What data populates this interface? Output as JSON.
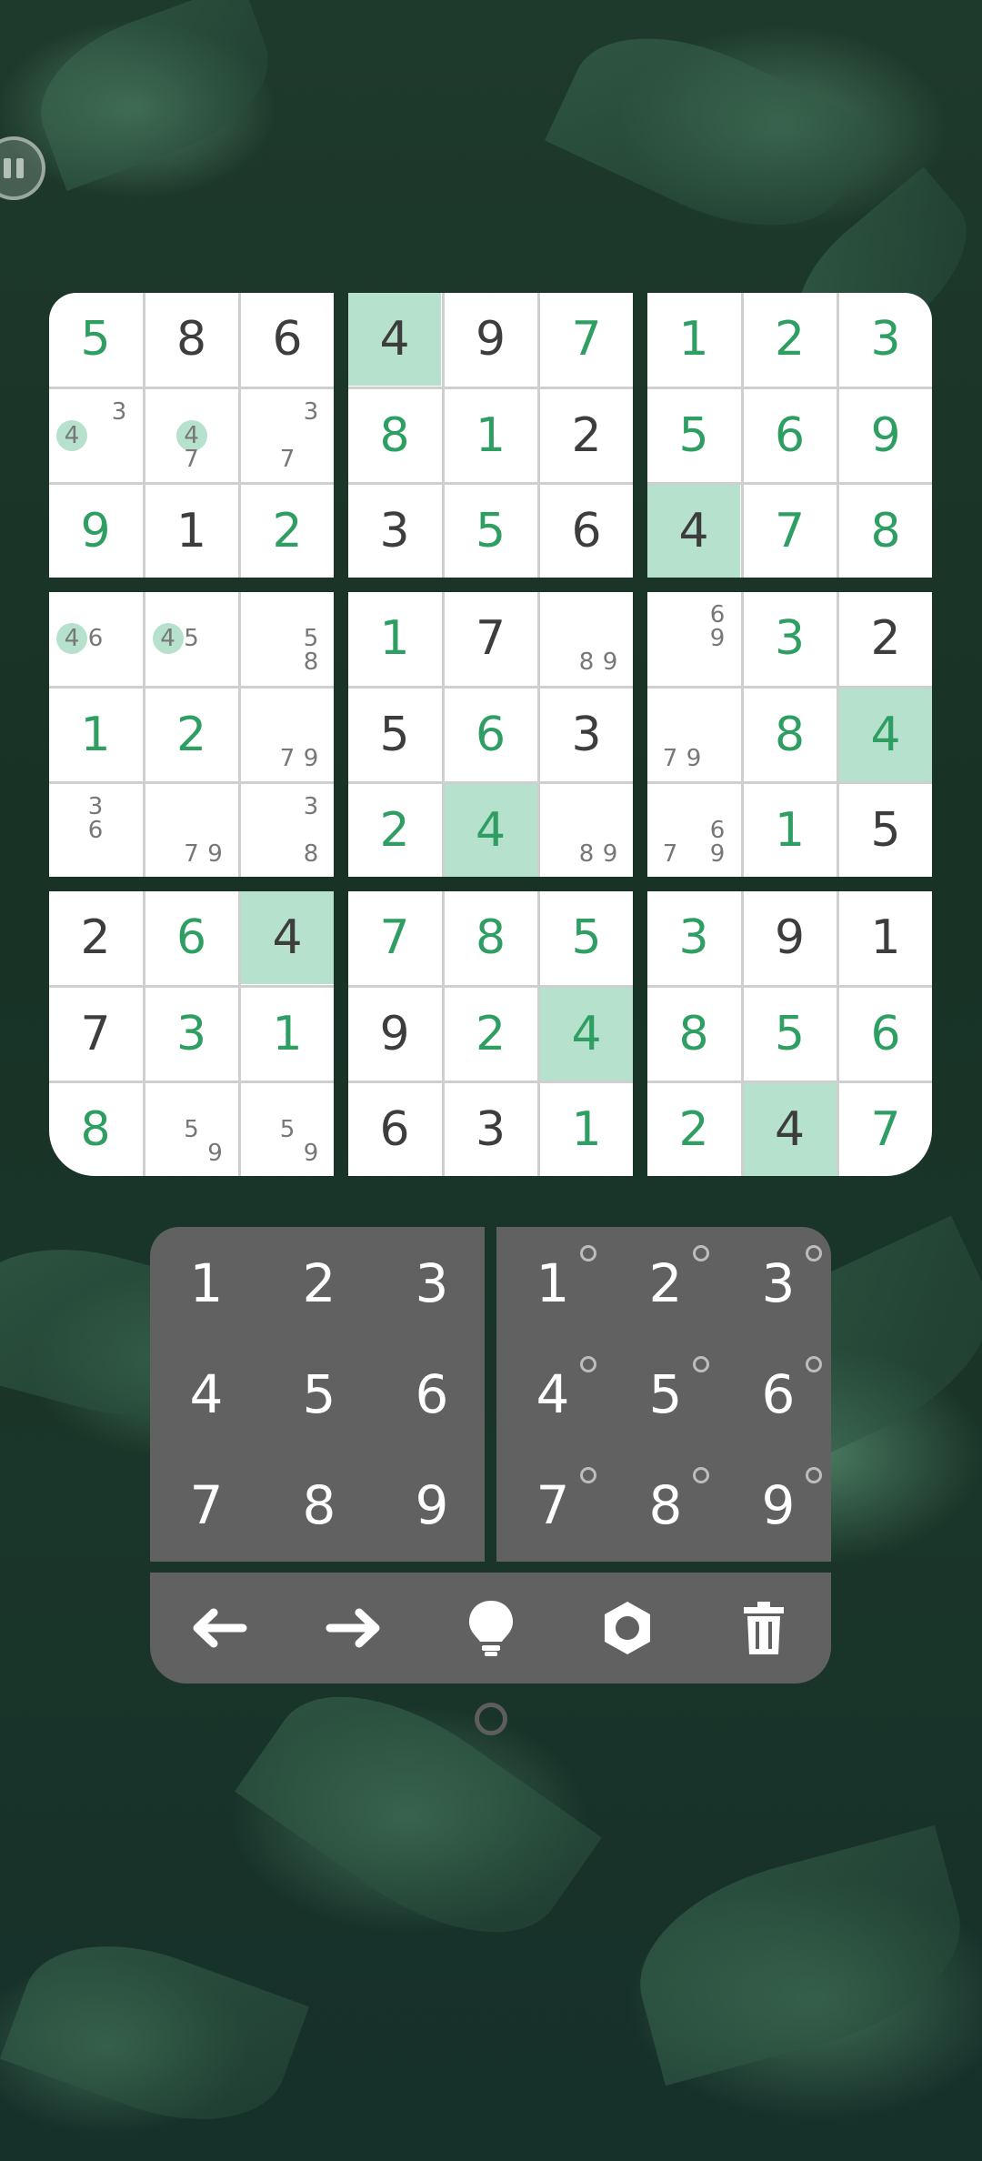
{
  "colors": {
    "accent": "#2e9e63",
    "highlight": "#b6e1cc",
    "given": "#3d3d3d",
    "pad": "#616161"
  },
  "board": {
    "boxes": [
      {
        "cells": [
          {
            "v": "5",
            "t": "user"
          },
          {
            "v": "8",
            "t": "given"
          },
          {
            "v": "6",
            "t": "given"
          },
          {
            "v": "",
            "notes": [
              {
                "d": "4",
                "pos": "ml",
                "mark": true
              },
              {
                "d": "3",
                "pos": "tr"
              }
            ]
          },
          {
            "v": "",
            "notes": [
              {
                "d": "4",
                "pos": "mc",
                "mark": true
              },
              {
                "d": "7",
                "pos": "bc"
              }
            ]
          },
          {
            "v": "",
            "notes": [
              {
                "d": "3",
                "pos": "tr"
              },
              {
                "d": "7",
                "pos": "bc"
              }
            ]
          },
          {
            "v": "9",
            "t": "user"
          },
          {
            "v": "1",
            "t": "given"
          },
          {
            "v": "2",
            "t": "user"
          }
        ]
      },
      {
        "cells": [
          {
            "v": "4",
            "t": "given",
            "hl": true
          },
          {
            "v": "9",
            "t": "given"
          },
          {
            "v": "7",
            "t": "user"
          },
          {
            "v": "8",
            "t": "user"
          },
          {
            "v": "1",
            "t": "user"
          },
          {
            "v": "2",
            "t": "given"
          },
          {
            "v": "3",
            "t": "given"
          },
          {
            "v": "5",
            "t": "user"
          },
          {
            "v": "6",
            "t": "given"
          }
        ]
      },
      {
        "cells": [
          {
            "v": "1",
            "t": "user"
          },
          {
            "v": "2",
            "t": "user"
          },
          {
            "v": "3",
            "t": "user"
          },
          {
            "v": "5",
            "t": "user"
          },
          {
            "v": "6",
            "t": "user"
          },
          {
            "v": "9",
            "t": "user"
          },
          {
            "v": "4",
            "t": "given",
            "hl": true
          },
          {
            "v": "7",
            "t": "user"
          },
          {
            "v": "8",
            "t": "user"
          }
        ]
      },
      {
        "cells": [
          {
            "v": "",
            "notes": [
              {
                "d": "4",
                "pos": "ml",
                "mark": true
              },
              {
                "d": "6",
                "pos": "mc"
              }
            ]
          },
          {
            "v": "",
            "notes": [
              {
                "d": "4",
                "pos": "ml",
                "mark": true
              },
              {
                "d": "5",
                "pos": "mc"
              }
            ]
          },
          {
            "v": "",
            "notes": [
              {
                "d": "5",
                "pos": "mr"
              },
              {
                "d": "8",
                "pos": "br"
              }
            ]
          },
          {
            "v": "1",
            "t": "user"
          },
          {
            "v": "2",
            "t": "user"
          },
          {
            "v": "",
            "notes": [
              {
                "d": "7",
                "pos": "bc"
              },
              {
                "d": "9",
                "pos": "br"
              }
            ]
          },
          {
            "v": "",
            "notes": [
              {
                "d": "3",
                "pos": "tc"
              },
              {
                "d": "6",
                "pos": "mc"
              }
            ]
          },
          {
            "v": "",
            "notes": [
              {
                "d": "7",
                "pos": "bc"
              },
              {
                "d": "9",
                "pos": "br"
              }
            ]
          },
          {
            "v": "",
            "notes": [
              {
                "d": "3",
                "pos": "tr"
              },
              {
                "d": "8",
                "pos": "br"
              }
            ]
          }
        ]
      },
      {
        "cells": [
          {
            "v": "1",
            "t": "user"
          },
          {
            "v": "7",
            "t": "given"
          },
          {
            "v": "",
            "notes": [
              {
                "d": "8",
                "pos": "bc"
              },
              {
                "d": "9",
                "pos": "br"
              }
            ]
          },
          {
            "v": "5",
            "t": "given"
          },
          {
            "v": "6",
            "t": "user"
          },
          {
            "v": "3",
            "t": "given"
          },
          {
            "v": "2",
            "t": "user"
          },
          {
            "v": "4",
            "t": "user",
            "hl": true
          },
          {
            "v": "",
            "notes": [
              {
                "d": "8",
                "pos": "bc"
              },
              {
                "d": "9",
                "pos": "br"
              }
            ]
          }
        ]
      },
      {
        "cells": [
          {
            "v": "",
            "notes": [
              {
                "d": "6",
                "pos": "tr"
              },
              {
                "d": "9",
                "pos": "mr"
              }
            ]
          },
          {
            "v": "3",
            "t": "user"
          },
          {
            "v": "2",
            "t": "given"
          },
          {
            "v": "",
            "notes": [
              {
                "d": "7",
                "pos": "bl"
              },
              {
                "d": "9",
                "pos": "bc"
              }
            ]
          },
          {
            "v": "8",
            "t": "user"
          },
          {
            "v": "4",
            "t": "user",
            "hl": true
          },
          {
            "v": "",
            "notes": [
              {
                "d": "7",
                "pos": "bl"
              },
              {
                "d": "6",
                "pos": "mr"
              },
              {
                "d": "9",
                "pos": "br"
              }
            ]
          },
          {
            "v": "1",
            "t": "user"
          },
          {
            "v": "5",
            "t": "given"
          }
        ]
      },
      {
        "cells": [
          {
            "v": "2",
            "t": "given"
          },
          {
            "v": "6",
            "t": "user"
          },
          {
            "v": "4",
            "t": "given",
            "hl": true
          },
          {
            "v": "7",
            "t": "given"
          },
          {
            "v": "3",
            "t": "user"
          },
          {
            "v": "1",
            "t": "user"
          },
          {
            "v": "8",
            "t": "user"
          },
          {
            "v": "",
            "notes": [
              {
                "d": "5",
                "pos": "mc"
              },
              {
                "d": "9",
                "pos": "br"
              }
            ]
          },
          {
            "v": "",
            "notes": [
              {
                "d": "5",
                "pos": "mc"
              },
              {
                "d": "9",
                "pos": "br"
              }
            ]
          }
        ]
      },
      {
        "cells": [
          {
            "v": "7",
            "t": "user"
          },
          {
            "v": "8",
            "t": "user"
          },
          {
            "v": "5",
            "t": "user"
          },
          {
            "v": "9",
            "t": "given"
          },
          {
            "v": "2",
            "t": "user"
          },
          {
            "v": "4",
            "t": "user",
            "hl": true
          },
          {
            "v": "6",
            "t": "given"
          },
          {
            "v": "3",
            "t": "given"
          },
          {
            "v": "1",
            "t": "user"
          }
        ]
      },
      {
        "cells": [
          {
            "v": "3",
            "t": "user"
          },
          {
            "v": "9",
            "t": "given"
          },
          {
            "v": "1",
            "t": "given"
          },
          {
            "v": "8",
            "t": "user"
          },
          {
            "v": "5",
            "t": "user"
          },
          {
            "v": "6",
            "t": "user"
          },
          {
            "v": "2",
            "t": "user"
          },
          {
            "v": "4",
            "t": "given",
            "hl": true
          },
          {
            "v": "7",
            "t": "user"
          }
        ]
      }
    ]
  },
  "numpad": {
    "digits": [
      "1",
      "2",
      "3",
      "4",
      "5",
      "6",
      "7",
      "8",
      "9"
    ]
  },
  "notepad": {
    "digits": [
      "1",
      "2",
      "3",
      "4",
      "5",
      "6",
      "7",
      "8",
      "9"
    ]
  },
  "toolbar": {
    "icons": [
      "arrow-left-icon",
      "arrow-right-icon",
      "lightbulb-icon",
      "gear-icon",
      "trash-icon"
    ]
  }
}
